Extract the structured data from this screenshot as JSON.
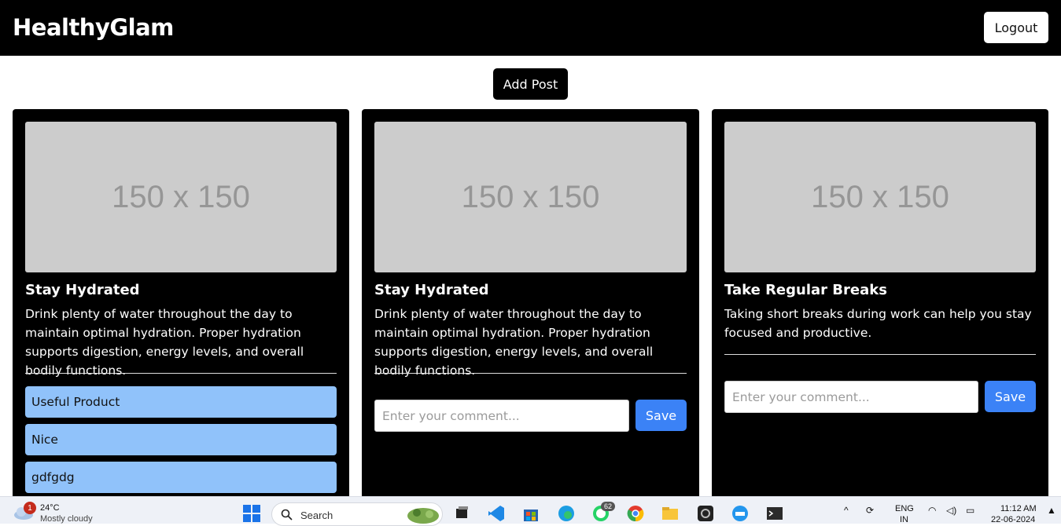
{
  "header": {
    "brand": "HealthyGlam",
    "logout_label": "Logout"
  },
  "main": {
    "add_post_label": "Add Post"
  },
  "posts": [
    {
      "image_placeholder": "150 x 150",
      "title": "Stay Hydrated",
      "body": "Drink plenty of water throughout the day to maintain optimal hydration. Proper hydration supports digestion, energy levels, and overall bodily functions.",
      "comments": [
        "Useful Product",
        "Nice",
        "gdfgdg"
      ]
    },
    {
      "image_placeholder": "150 x 150",
      "title": "Stay Hydrated",
      "body": "Drink plenty of water throughout the day to maintain optimal hydration. Proper hydration supports digestion, energy levels, and overall bodily functions.",
      "comment_placeholder": "Enter your comment...",
      "save_label": "Save"
    },
    {
      "image_placeholder": "150 x 150",
      "title": "Take Regular Breaks",
      "body": "Taking short breaks during work can help you stay focused and productive.",
      "comment_placeholder": "Enter your comment...",
      "save_label": "Save"
    }
  ],
  "taskbar": {
    "weather_temp": "24°C",
    "weather_desc": "Mostly cloudy",
    "weather_badge": "1",
    "search_label": "Search",
    "whatsapp_badge": "62",
    "language": "ENG",
    "region": "IN",
    "time": "11:12 AM",
    "date": "22-06-2024"
  },
  "colors": {
    "header_bg": "#000000",
    "card_bg": "#000000",
    "comment_bg": "#90c2fa",
    "save_bg": "#3b82f6",
    "image_placeholder_bg": "#cccccc"
  }
}
